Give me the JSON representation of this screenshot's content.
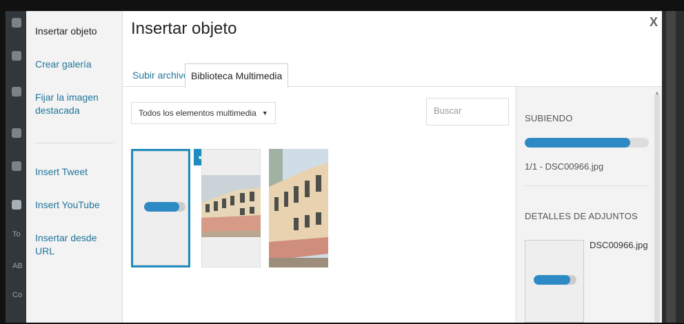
{
  "menu": {
    "items": [
      {
        "label": "Insertar objeto",
        "active": true
      },
      {
        "label": "Crear galería"
      },
      {
        "label": "Fijar la imagen destacada"
      },
      {
        "label": "Insert Tweet"
      },
      {
        "label": "Insert YouTube"
      },
      {
        "label": "Insertar desde URL"
      }
    ]
  },
  "wp_admin": {
    "labels": [
      "To",
      "AB",
      "Co"
    ]
  },
  "frame": {
    "title": "Insertar objeto",
    "close_label": "X"
  },
  "tabs": [
    {
      "label": "Subir archivos"
    },
    {
      "label": "Biblioteca Multimedia",
      "active": true
    }
  ],
  "toolbar": {
    "filter_value": "Todos los elementos multimedia",
    "filter_arrow": "▼",
    "search_placeholder": "Buscar"
  },
  "attachments": [
    {
      "type": "uploading",
      "progress": 0.85,
      "selected": true,
      "check": "✓"
    },
    {
      "type": "image",
      "description": "building-photo"
    },
    {
      "type": "image",
      "description": "building-photo"
    }
  ],
  "sidebar": {
    "uploading_heading": "SUBIENDO",
    "upload_progress": 0.85,
    "upload_status": "1/1 - DSC00966.jpg",
    "details_heading": "DETALLES DE ADJUNTOS",
    "file_name": "DSC00966.jpg",
    "thumb_progress": 0.85
  },
  "colors": {
    "accent": "#1e8cbe",
    "link": "#21759b",
    "progress": "#2e8ac4"
  }
}
